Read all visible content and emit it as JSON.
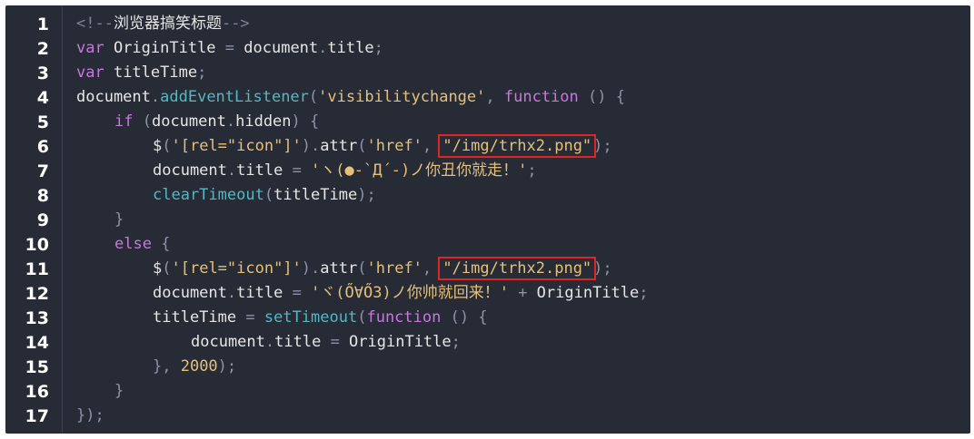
{
  "colors": {
    "background": "#272b35",
    "keyword": "#c678dd",
    "function": "#56b6c2",
    "string": "#e5c07b",
    "plain": "#e6e6e6",
    "punctuation": "#8b93a6",
    "comment": "#7b8396",
    "highlight_box": "#e02424"
  },
  "lines": [
    {
      "num": "1",
      "indent": 0,
      "tokens": [
        {
          "t": "<!--",
          "c": "cmt"
        },
        {
          "t": "浏览器搞笑标题",
          "c": "plain"
        },
        {
          "t": "-->",
          "c": "cmt"
        }
      ]
    },
    {
      "num": "2",
      "indent": 0,
      "tokens": [
        {
          "t": "var",
          "c": "kw"
        },
        {
          "t": " OriginTitle ",
          "c": "plain"
        },
        {
          "t": "=",
          "c": "op"
        },
        {
          "t": " document",
          "c": "plain"
        },
        {
          "t": ".",
          "c": "punc"
        },
        {
          "t": "title",
          "c": "plain"
        },
        {
          "t": ";",
          "c": "punc"
        }
      ]
    },
    {
      "num": "3",
      "indent": 0,
      "tokens": [
        {
          "t": "var",
          "c": "kw"
        },
        {
          "t": " titleTime",
          "c": "plain"
        },
        {
          "t": ";",
          "c": "punc"
        }
      ]
    },
    {
      "num": "4",
      "indent": 0,
      "tokens": [
        {
          "t": "document",
          "c": "plain"
        },
        {
          "t": ".",
          "c": "punc"
        },
        {
          "t": "addEventListener",
          "c": "fn"
        },
        {
          "t": "(",
          "c": "punc"
        },
        {
          "t": "'visibilitychange'",
          "c": "str"
        },
        {
          "t": ", ",
          "c": "punc"
        },
        {
          "t": "function",
          "c": "kw"
        },
        {
          "t": " () {",
          "c": "punc"
        }
      ]
    },
    {
      "num": "5",
      "indent": 1,
      "tokens": [
        {
          "t": "if",
          "c": "kw"
        },
        {
          "t": " (",
          "c": "punc"
        },
        {
          "t": "document",
          "c": "plain"
        },
        {
          "t": ".",
          "c": "punc"
        },
        {
          "t": "hidden",
          "c": "plain"
        },
        {
          "t": ") {",
          "c": "punc"
        }
      ]
    },
    {
      "num": "6",
      "indent": 2,
      "tokens": [
        {
          "t": "$",
          "c": "plain"
        },
        {
          "t": "(",
          "c": "punc"
        },
        {
          "t": "'[rel=\"icon\"]'",
          "c": "str"
        },
        {
          "t": ")",
          "c": "punc"
        },
        {
          "t": ".",
          "c": "punc"
        },
        {
          "t": "attr",
          "c": "plain"
        },
        {
          "t": "(",
          "c": "punc"
        },
        {
          "t": "'href'",
          "c": "str"
        },
        {
          "t": ", ",
          "c": "punc"
        },
        {
          "t": "\"/img/trhx2.png\"",
          "c": "str",
          "hl": true
        },
        {
          "t": ");",
          "c": "punc"
        }
      ]
    },
    {
      "num": "7",
      "indent": 2,
      "tokens": [
        {
          "t": "document",
          "c": "plain"
        },
        {
          "t": ".",
          "c": "punc"
        },
        {
          "t": "title ",
          "c": "plain"
        },
        {
          "t": "=",
          "c": "op"
        },
        {
          "t": " ",
          "c": "plain"
        },
        {
          "t": "'ヽ(●-`Д´-)ノ你丑你就走！'",
          "c": "str"
        },
        {
          "t": ";",
          "c": "punc"
        }
      ]
    },
    {
      "num": "8",
      "indent": 2,
      "tokens": [
        {
          "t": "clearTimeout",
          "c": "fn"
        },
        {
          "t": "(",
          "c": "punc"
        },
        {
          "t": "titleTime",
          "c": "plain"
        },
        {
          "t": ");",
          "c": "punc"
        }
      ]
    },
    {
      "num": "9",
      "indent": 1,
      "tokens": [
        {
          "t": "}",
          "c": "punc"
        }
      ]
    },
    {
      "num": "10",
      "indent": 1,
      "tokens": [
        {
          "t": "else",
          "c": "kw"
        },
        {
          "t": " {",
          "c": "punc"
        }
      ]
    },
    {
      "num": "11",
      "indent": 2,
      "tokens": [
        {
          "t": "$",
          "c": "plain"
        },
        {
          "t": "(",
          "c": "punc"
        },
        {
          "t": "'[rel=\"icon\"]'",
          "c": "str"
        },
        {
          "t": ")",
          "c": "punc"
        },
        {
          "t": ".",
          "c": "punc"
        },
        {
          "t": "attr",
          "c": "plain"
        },
        {
          "t": "(",
          "c": "punc"
        },
        {
          "t": "'href'",
          "c": "str"
        },
        {
          "t": ", ",
          "c": "punc"
        },
        {
          "t": "\"/img/trhx2.png\"",
          "c": "str",
          "hl": true
        },
        {
          "t": ");",
          "c": "punc"
        }
      ]
    },
    {
      "num": "12",
      "indent": 2,
      "tokens": [
        {
          "t": "document",
          "c": "plain"
        },
        {
          "t": ".",
          "c": "punc"
        },
        {
          "t": "title ",
          "c": "plain"
        },
        {
          "t": "=",
          "c": "op"
        },
        {
          "t": " ",
          "c": "plain"
        },
        {
          "t": "'ヾ(Ő∀Ő3)ノ你帅就回来！'",
          "c": "str"
        },
        {
          "t": " + ",
          "c": "op"
        },
        {
          "t": "OriginTitle",
          "c": "plain"
        },
        {
          "t": ";",
          "c": "punc"
        }
      ]
    },
    {
      "num": "13",
      "indent": 2,
      "tokens": [
        {
          "t": "titleTime ",
          "c": "plain"
        },
        {
          "t": "=",
          "c": "op"
        },
        {
          "t": " ",
          "c": "plain"
        },
        {
          "t": "setTimeout",
          "c": "fn"
        },
        {
          "t": "(",
          "c": "punc"
        },
        {
          "t": "function",
          "c": "kw"
        },
        {
          "t": " () {",
          "c": "punc"
        }
      ]
    },
    {
      "num": "14",
      "indent": 3,
      "tokens": [
        {
          "t": "document",
          "c": "plain"
        },
        {
          "t": ".",
          "c": "punc"
        },
        {
          "t": "title ",
          "c": "plain"
        },
        {
          "t": "=",
          "c": "op"
        },
        {
          "t": " OriginTitle",
          "c": "plain"
        },
        {
          "t": ";",
          "c": "punc"
        }
      ]
    },
    {
      "num": "15",
      "indent": 2,
      "tokens": [
        {
          "t": "}, ",
          "c": "punc"
        },
        {
          "t": "2000",
          "c": "num"
        },
        {
          "t": ");",
          "c": "punc"
        }
      ]
    },
    {
      "num": "16",
      "indent": 1,
      "tokens": [
        {
          "t": "}",
          "c": "punc"
        }
      ]
    },
    {
      "num": "17",
      "indent": 0,
      "tokens": [
        {
          "t": "});",
          "c": "punc"
        }
      ]
    }
  ]
}
